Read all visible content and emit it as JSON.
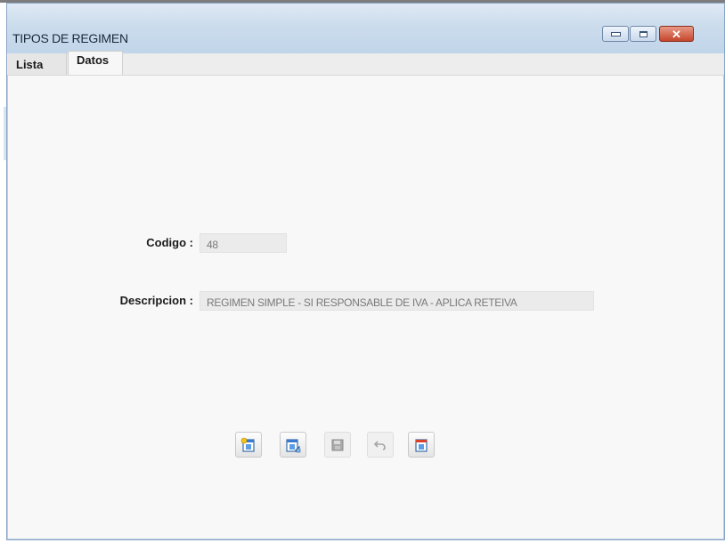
{
  "window": {
    "title": "TIPOS DE REGIMEN",
    "controls": {
      "minimize_icon": "minimize-icon",
      "maximize_icon": "maximize-icon",
      "close_icon": "close-icon",
      "close_glyph": "✕"
    }
  },
  "tabs": [
    {
      "label": "Lista",
      "active": false
    },
    {
      "label": "Datos",
      "active": true
    }
  ],
  "form": {
    "codigo_label": "Codigo :",
    "codigo_value": "48",
    "descripcion_label": "Descripcion :",
    "descripcion_value": "REGIMEN SIMPLE - SI RESPONSABLE DE IVA - APLICA RETEIVA"
  },
  "toolbar": [
    {
      "icon": "new-record-icon",
      "enabled": true
    },
    {
      "icon": "edit-record-icon",
      "enabled": true
    },
    {
      "icon": "save-icon",
      "enabled": false
    },
    {
      "icon": "undo-icon",
      "enabled": false
    },
    {
      "icon": "delete-record-icon",
      "enabled": true
    }
  ],
  "colors": {
    "accent": "#c4452b",
    "frame": "#b8cfe6",
    "content_bg": "#f8f8f8"
  }
}
